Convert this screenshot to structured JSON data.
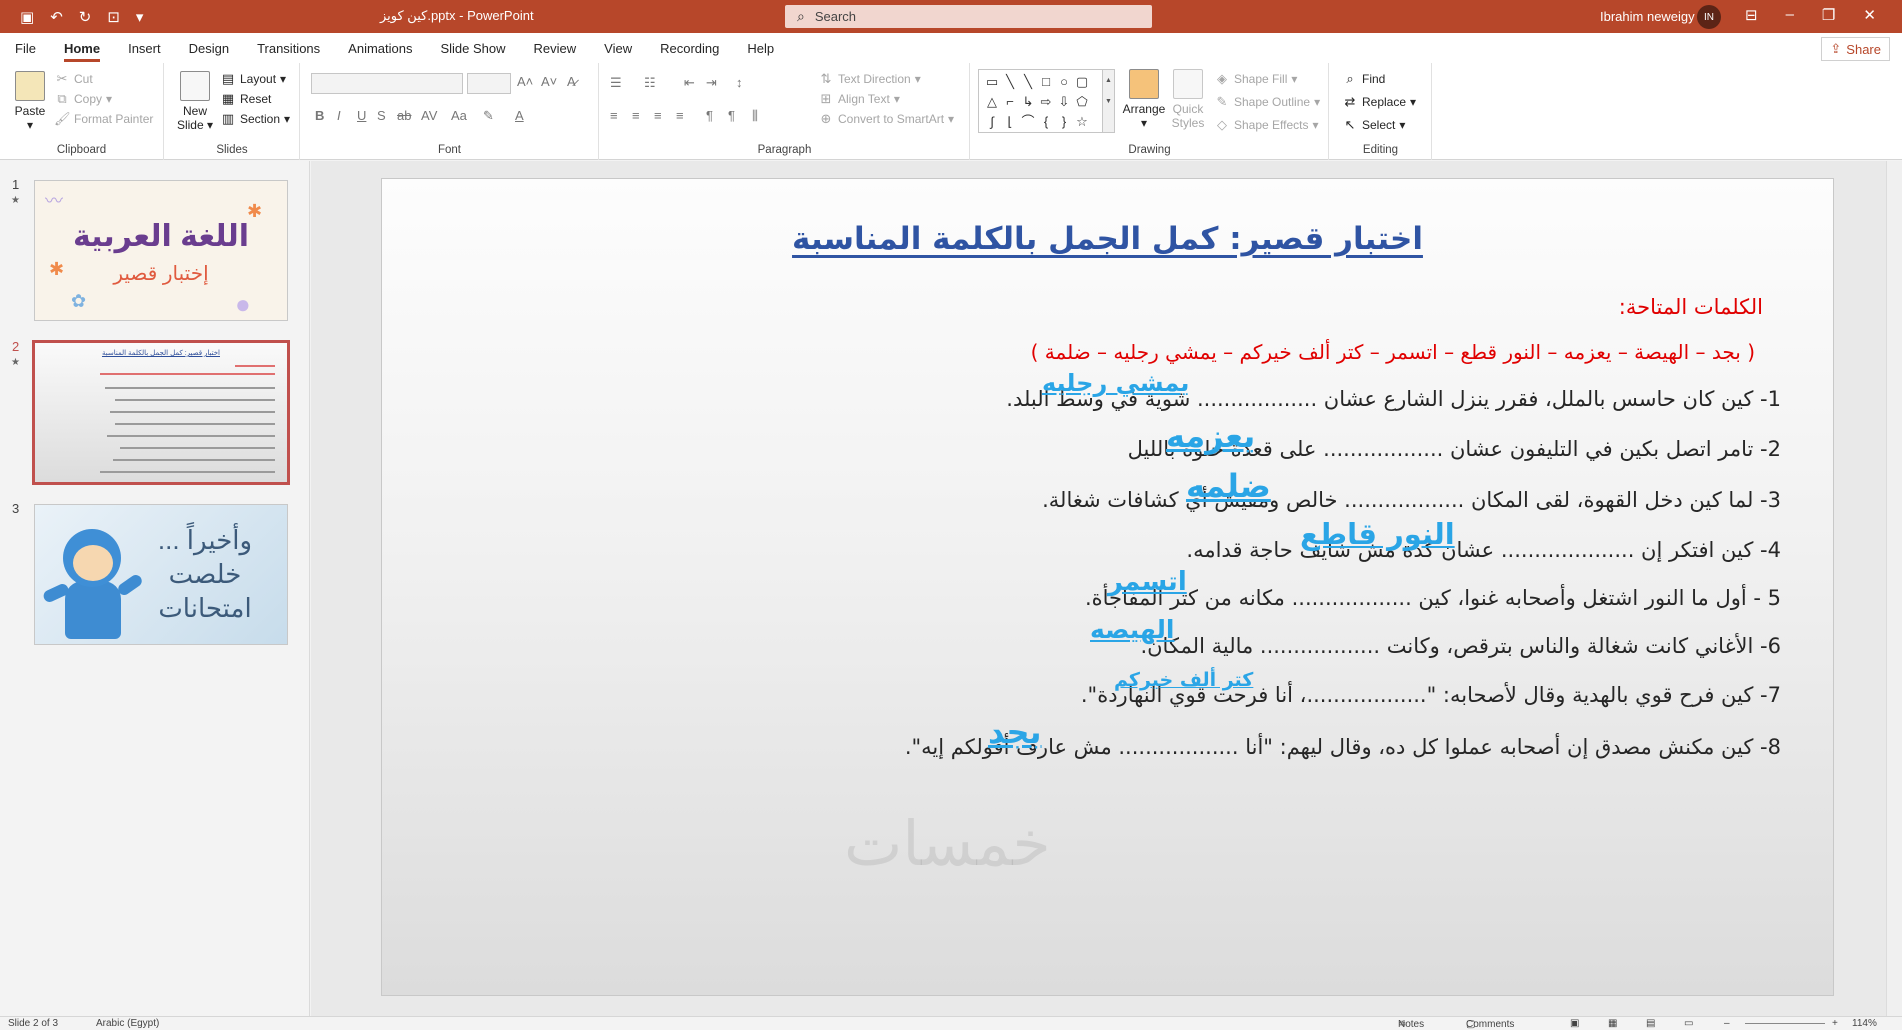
{
  "titlebar": {
    "document_title": "كين كويز.pptx",
    "separator": " - ",
    "app_name": "PowerPoint",
    "search_placeholder": "Search",
    "user_name": "Ibrahim neweigy",
    "user_initials": "IN"
  },
  "menu": {
    "tabs": [
      "File",
      "Home",
      "Insert",
      "Design",
      "Transitions",
      "Animations",
      "Slide Show",
      "Review",
      "View",
      "Recording",
      "Help"
    ],
    "active": "Home",
    "share_label": "Share"
  },
  "ribbon": {
    "clipboard": {
      "label": "Clipboard",
      "paste": "Paste",
      "cut": "Cut",
      "copy": "Copy",
      "format_painter": "Format Painter"
    },
    "slides": {
      "label": "Slides",
      "new_slide": "New Slide",
      "layout": "Layout",
      "reset": "Reset",
      "section": "Section"
    },
    "font": {
      "label": "Font"
    },
    "paragraph": {
      "label": "Paragraph",
      "text_direction": "Text Direction",
      "align_text": "Align Text",
      "convert_smartart": "Convert to SmartArt"
    },
    "drawing": {
      "label": "Drawing",
      "arrange": "Arrange",
      "quick_styles": "Quick Styles",
      "shape_fill": "Shape Fill",
      "shape_outline": "Shape Outline",
      "shape_effects": "Shape Effects"
    },
    "editing": {
      "label": "Editing",
      "find": "Find",
      "replace": "Replace",
      "select": "Select"
    }
  },
  "thumbnails": [
    {
      "number": "1",
      "title": "اللغة العربية",
      "subtitle": "إختبار قصير"
    },
    {
      "number": "2",
      "title": "اختبار قصير: كمل الجمل بالكلمة المناسبة"
    },
    {
      "number": "3",
      "line1": "وأخيراً ...",
      "line2": "خلصت",
      "line3": "امتحانات"
    }
  ],
  "slide": {
    "title": "اختبار قصير: كمل الجمل بالكلمة المناسبة",
    "words_label": "الكلمات المتاحة:",
    "word_bank": "( بجد – الهيصة – يعزمه – النور قطع – اتسمر – كتر ألف خيركم – يمشي رجليه – ضلمة )",
    "questions": [
      {
        "text": "1- كين كان حاسس بالملل، فقرر ينزل الشارع عشان .................. شوية في وسط البلد.",
        "answer": "يمشي رجليه"
      },
      {
        "text": "2- تامر اتصل بكين في التليفون عشان .................. على قعدة حلوة بالليل",
        "answer": "يعزمه"
      },
      {
        "text": "3- لما كين دخل القهوة، لقى المكان .................. خالص ومفيش أي كشافات شغالة.",
        "answer": "ضلمه"
      },
      {
        "text": "4- كين افتكر إن .................... عشان كدة مش شايف حاجة قدامه.",
        "answer": "النور قاطع"
      },
      {
        "text": "5 - أول ما النور اشتغل وأصحابه غنوا، كين .................. مكانه من كتر المفاجأة.",
        "answer": "اتسمر"
      },
      {
        "text": "6- الأغاني كانت شغالة والناس بترقص، وكانت .................. مالية المكان.",
        "answer": "الهيصه"
      },
      {
        "text": "7- كين فرح قوي بالهدية وقال لأصحابه: \"..................، أنا فرحت قوي النهاردة\".",
        "answer": "كتر ألف خيركم"
      },
      {
        "text": "8- كين مكنش مصدق إن أصحابه عملوا كل ده، وقال ليهم: \"أنا .................. مش عارف أقولكم إيه\".",
        "answer": "بجد"
      }
    ],
    "watermark": "خمسات"
  },
  "status": {
    "slide_counter": "Slide 2 of 3",
    "language": "Arabic (Egypt)",
    "notes": "Notes",
    "comments": "Comments",
    "zoom": "114%"
  },
  "colors": {
    "accent": "#b7472a",
    "title_blue": "#2f54a3",
    "answer_blue": "#2aa5e6",
    "word_red": "#e00000"
  }
}
